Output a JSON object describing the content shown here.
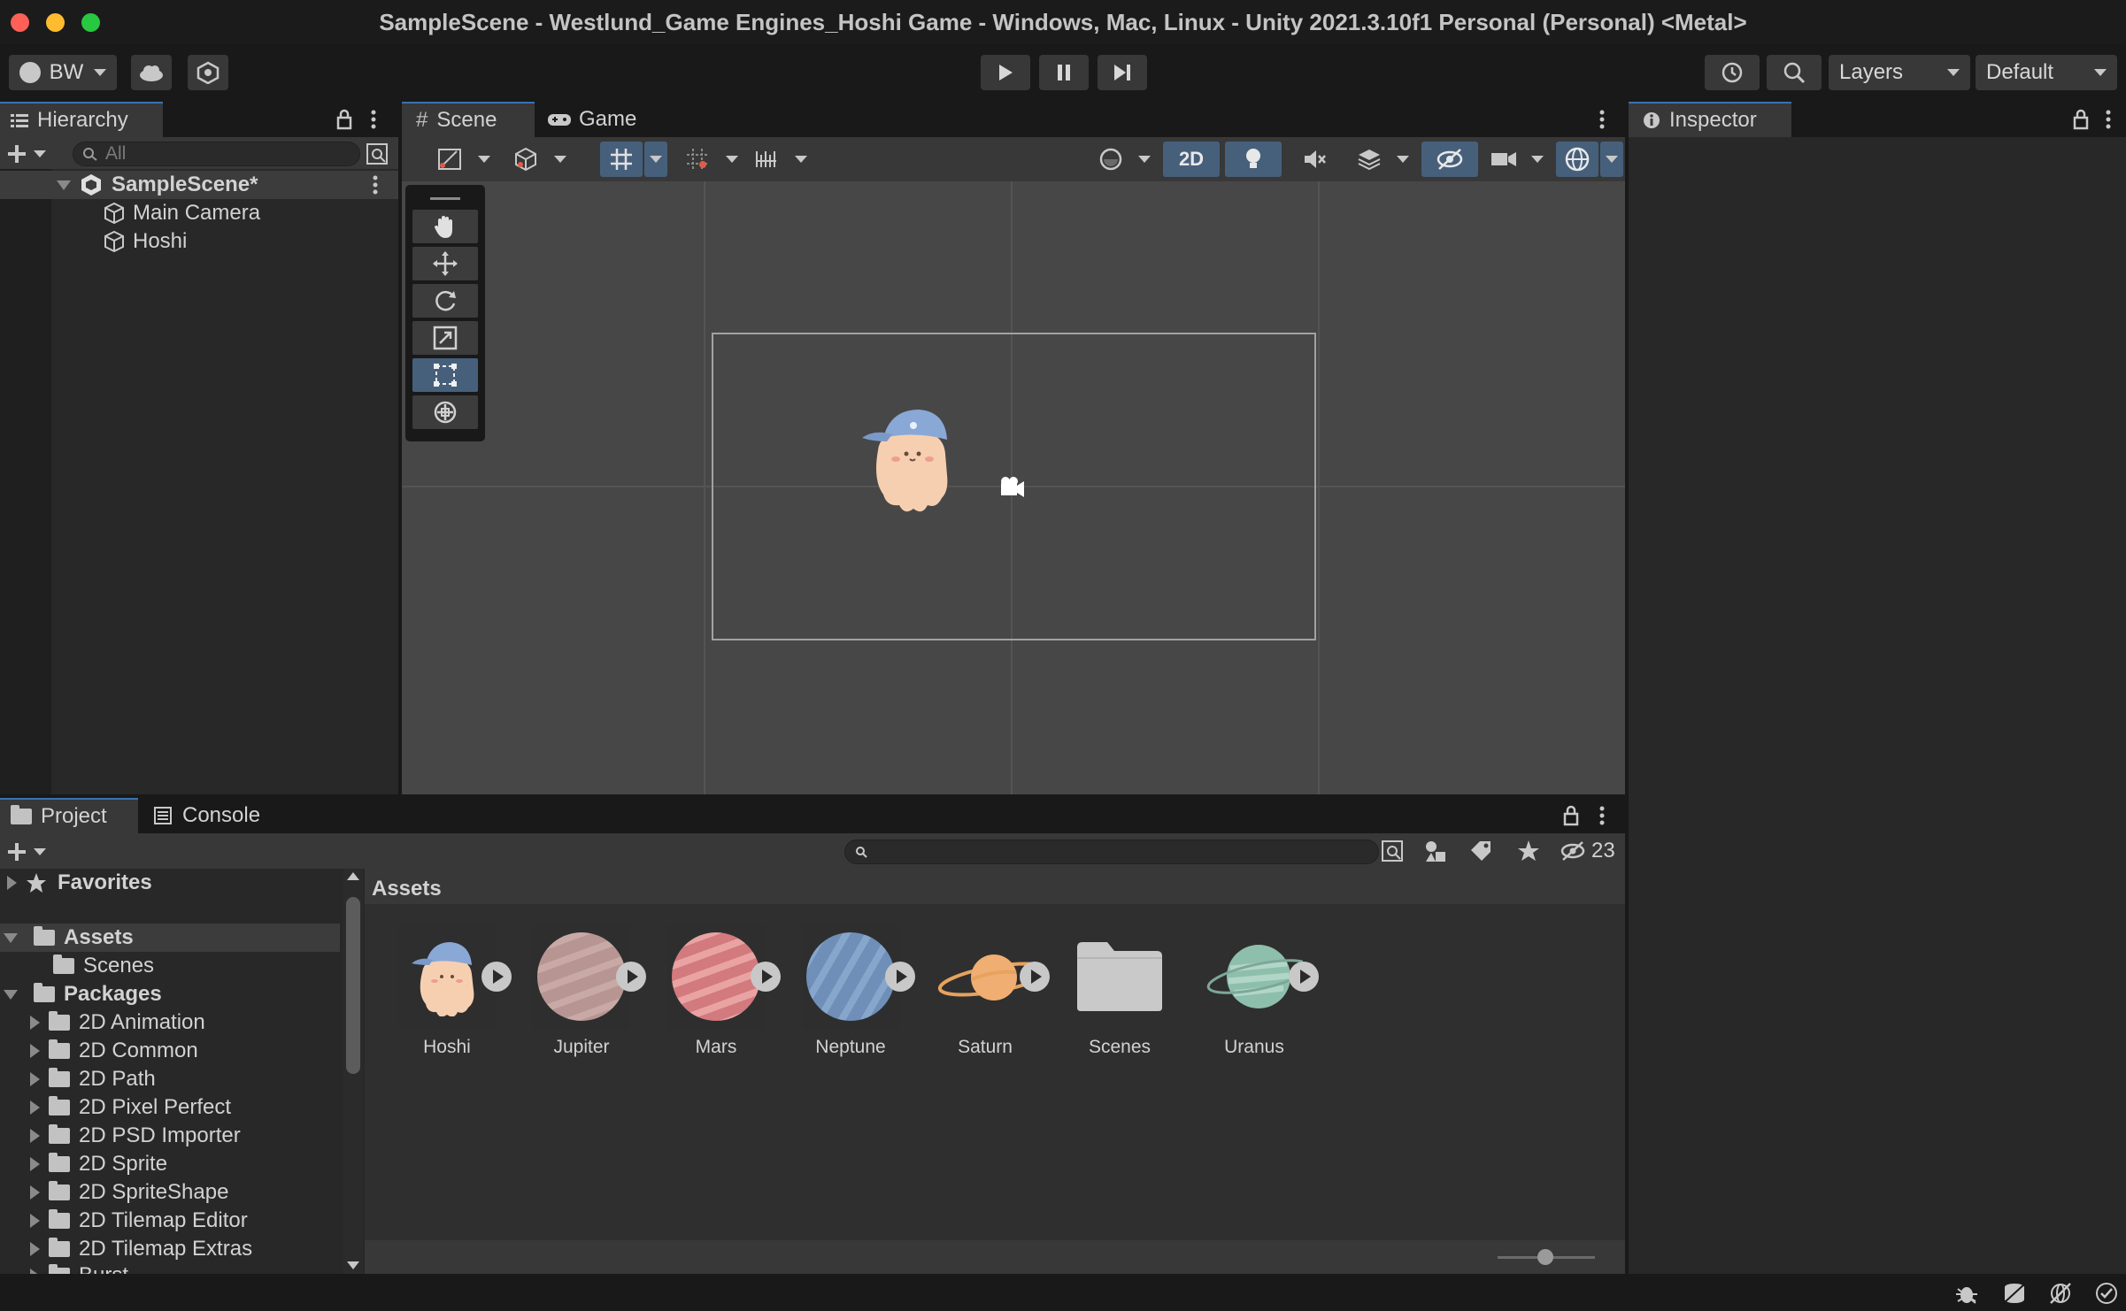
{
  "window": {
    "title": "SampleScene - Westlund_Game Engines_Hoshi Game - Windows, Mac, Linux - Unity 2021.3.10f1 Personal (Personal) <Metal>"
  },
  "toolbar": {
    "account": "BW",
    "layers_label": "Layers",
    "layout_label": "Default"
  },
  "hierarchy": {
    "tab": "Hierarchy",
    "search_placeholder": "All",
    "scene": "SampleScene*",
    "items": [
      "Main Camera",
      "Hoshi"
    ]
  },
  "scene_view": {
    "tabs": [
      "Scene",
      "Game"
    ],
    "mode_2d": "2D"
  },
  "inspector": {
    "tab": "Inspector"
  },
  "project": {
    "tabs": [
      "Project",
      "Console"
    ],
    "hidden_count": "23",
    "breadcrumb": "Assets",
    "tree": {
      "favorites": "Favorites",
      "assets": "Assets",
      "assets_children": [
        "Scenes"
      ],
      "packages": "Packages",
      "package_items": [
        "2D Animation",
        "2D Common",
        "2D Path",
        "2D Pixel Perfect",
        "2D PSD Importer",
        "2D Sprite",
        "2D SpriteShape",
        "2D Tilemap Editor",
        "2D Tilemap Extras",
        "Burst"
      ]
    },
    "assets": [
      {
        "name": "Hoshi",
        "kind": "sprite"
      },
      {
        "name": "Jupiter",
        "kind": "sprite",
        "color": "#b69592"
      },
      {
        "name": "Mars",
        "kind": "sprite",
        "color": "#d27a7e"
      },
      {
        "name": "Neptune",
        "kind": "sprite",
        "color": "#6f8fb8"
      },
      {
        "name": "Saturn",
        "kind": "sprite",
        "color": "#f0ae72"
      },
      {
        "name": "Scenes",
        "kind": "folder"
      },
      {
        "name": "Uranus",
        "kind": "sprite",
        "color": "#8ebfad"
      }
    ]
  },
  "colors": {
    "accent": "#46607c",
    "panel": "#282828",
    "scene_bg": "#474747"
  }
}
